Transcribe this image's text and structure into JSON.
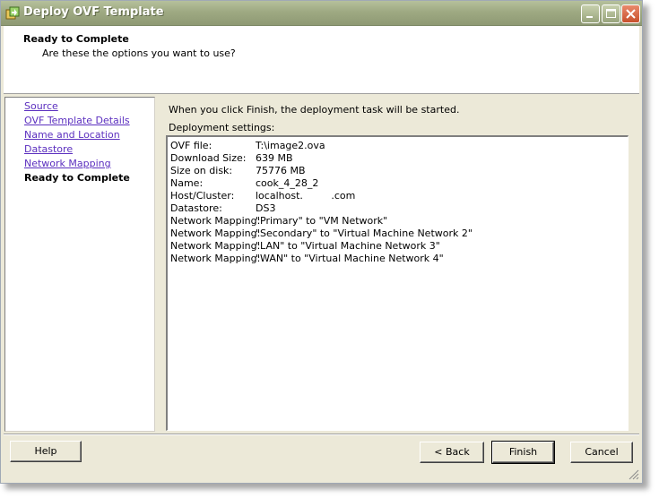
{
  "window": {
    "title": "Deploy OVF Template",
    "icon": "ovf-template-icon",
    "controls": [
      "minimize",
      "maximize",
      "close"
    ]
  },
  "header": {
    "title": "Ready to Complete",
    "subtitle": "Are these the options you want to use?"
  },
  "nav": {
    "items": [
      {
        "label": "Source",
        "current": false
      },
      {
        "label": "OVF Template Details",
        "current": false
      },
      {
        "label": "Name and Location",
        "current": false
      },
      {
        "label": "Datastore",
        "current": false
      },
      {
        "label": "Network Mapping",
        "current": false
      },
      {
        "label": "Ready to Complete",
        "current": true
      }
    ]
  },
  "main": {
    "intro": "When you click Finish, the deployment task will be started.",
    "settings_label": "Deployment settings:",
    "settings": [
      {
        "key": "OVF file:",
        "value": "T:\\image2.ova"
      },
      {
        "key": "Download Size:",
        "value": "639 MB"
      },
      {
        "key": "Size on disk:",
        "value": "75776 MB"
      },
      {
        "key": "Name:",
        "value": "cook_4_28_2"
      },
      {
        "key": "Host/Cluster:",
        "value": "localhost.         .com"
      },
      {
        "key": "Datastore:",
        "value": "DS3"
      },
      {
        "key": "Network Mapping:",
        "value": "\"Primary\" to \"VM Network\""
      },
      {
        "key": "Network Mapping:",
        "value": "\"Secondary\" to \"Virtual Machine Network 2\""
      },
      {
        "key": "Network Mapping:",
        "value": "\"LAN\" to \"Virtual Machine Network 3\""
      },
      {
        "key": "Network Mapping:",
        "value": "\"WAN\" to \"Virtual Machine Network 4\""
      }
    ]
  },
  "buttons": {
    "help": "Help",
    "back": "< Back",
    "finish": "Finish",
    "cancel": "Cancel"
  },
  "colors": {
    "titlebar": "#9ea982",
    "dialog_bg": "#ece9d8",
    "link": "#5b2fbf"
  }
}
